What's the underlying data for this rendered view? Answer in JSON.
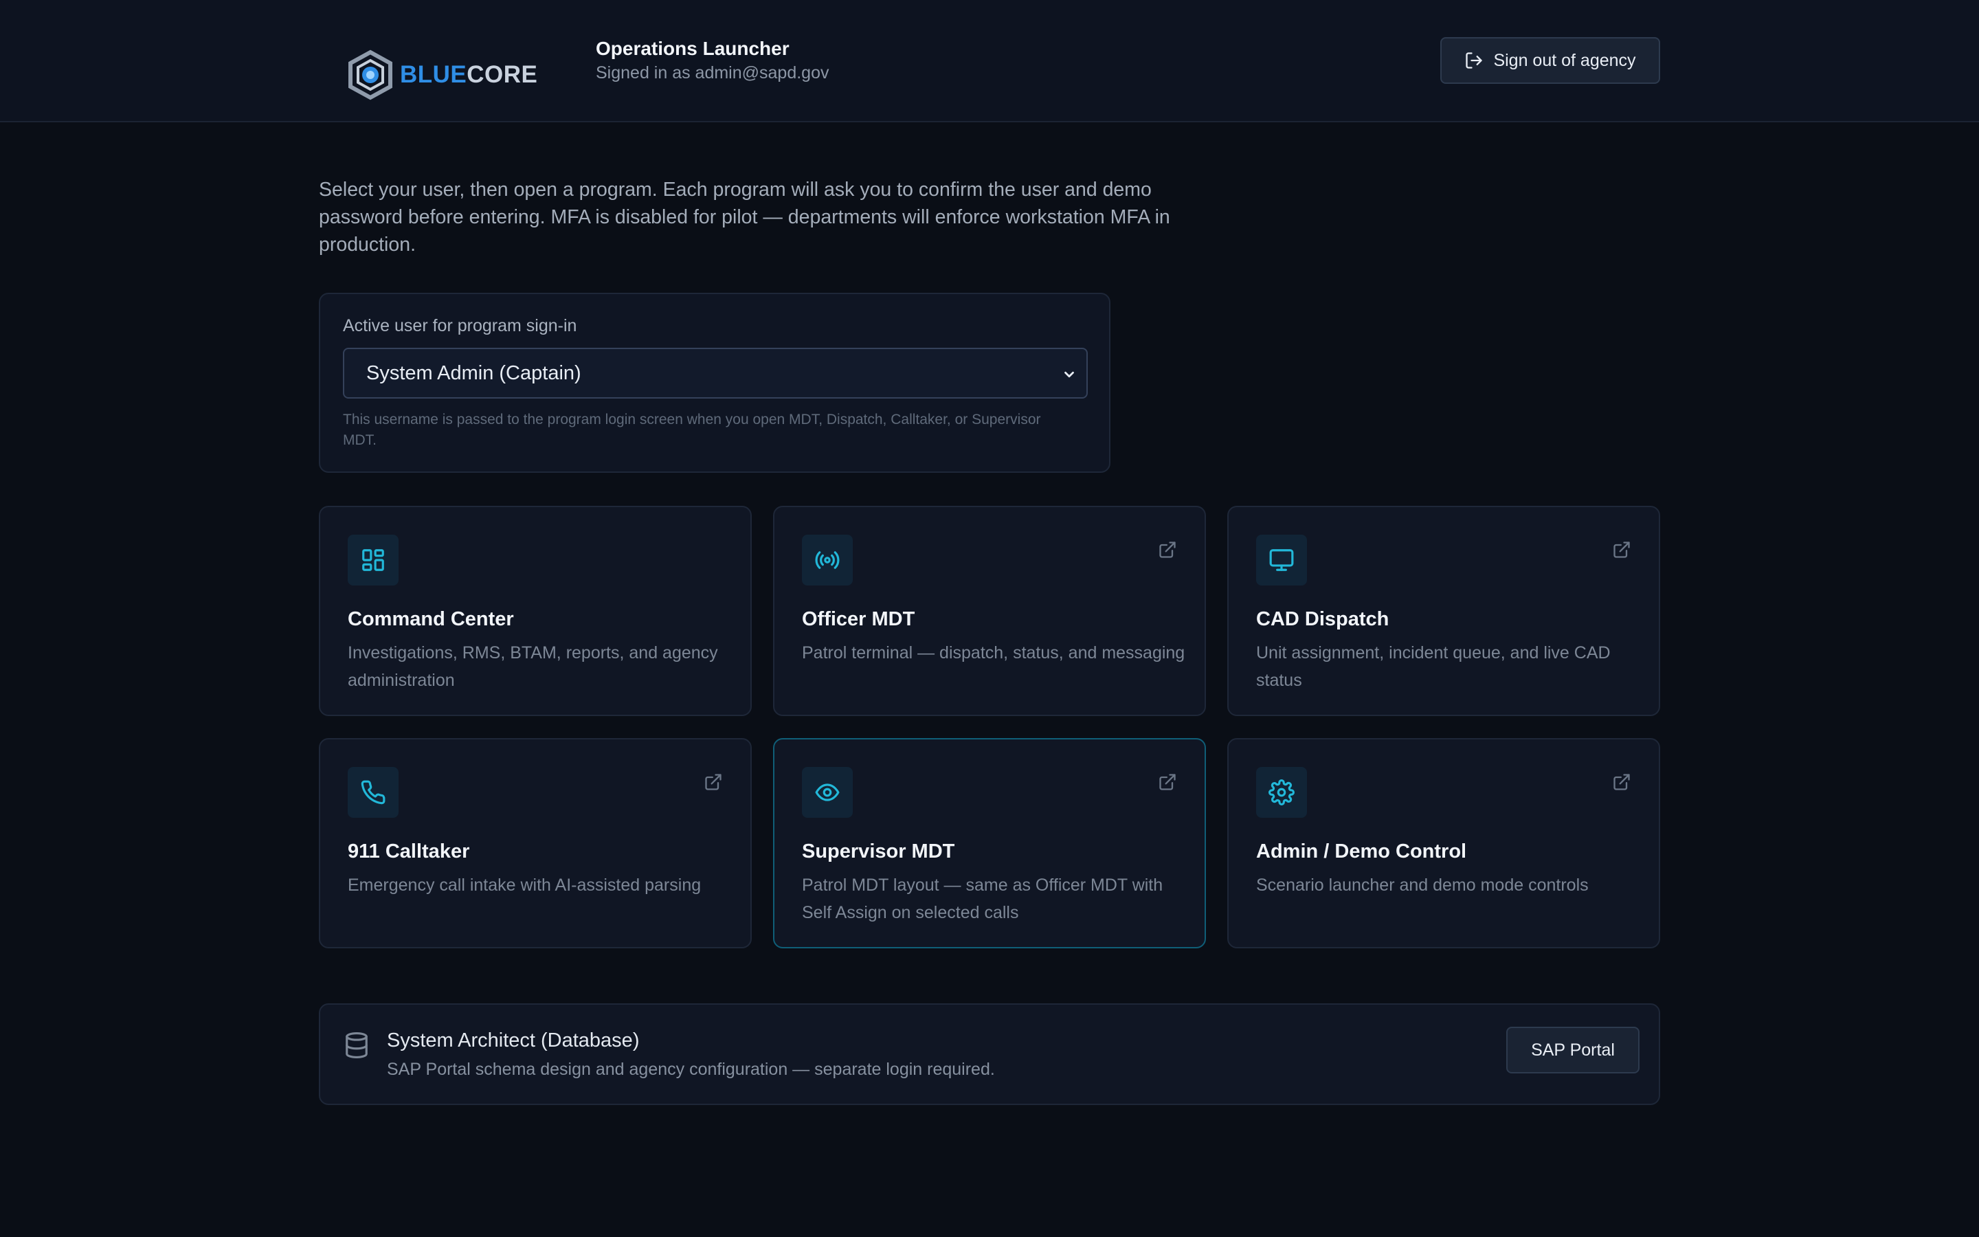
{
  "brand": {
    "logo_blue": "BLUE",
    "logo_core": "CORE"
  },
  "header": {
    "title": "Operations Launcher",
    "subtitle": "Signed in as admin@sapd.gov",
    "signout_label": "Sign out of agency"
  },
  "intro": "Select your user, then open a program. Each program will ask you to confirm the user and demo password before entering. MFA is disabled for pilot — departments will enforce workstation MFA in production.",
  "user_panel": {
    "label": "Active user for program sign-in",
    "selected": "System Admin (Captain)",
    "hint": "This username is passed to the program login screen when you open MDT, Dispatch, Calltaker, or Supervisor MDT."
  },
  "programs": [
    {
      "title": "Command Center",
      "desc": "Investigations, RMS, BTAM, reports, and agency administration",
      "icon": "grid-icon",
      "external": false
    },
    {
      "title": "Officer MDT",
      "desc": "Patrol terminal — dispatch, status, and messaging",
      "icon": "radio-icon",
      "external": true
    },
    {
      "title": "CAD Dispatch",
      "desc": "Unit assignment, incident queue, and live CAD status",
      "icon": "monitor-icon",
      "external": true
    },
    {
      "title": "911 Calltaker",
      "desc": "Emergency call intake with AI-assisted parsing",
      "icon": "phone-icon",
      "external": true
    },
    {
      "title": "Supervisor MDT",
      "desc": "Patrol MDT layout — same as Officer MDT with Self Assign on selected calls",
      "icon": "eye-icon",
      "external": true
    },
    {
      "title": "Admin / Demo Control",
      "desc": "Scenario launcher and demo mode controls",
      "icon": "gear-icon",
      "external": true
    }
  ],
  "architect": {
    "title": "System Architect (Database)",
    "desc": "SAP Portal schema design and agency configuration — separate login required.",
    "button": "SAP Portal",
    "icon": "database-icon"
  },
  "colors": {
    "background": "#0a0e16",
    "accent": "#22b8d9",
    "card_border": "#1e2738",
    "active_border": "#0f5e77"
  }
}
